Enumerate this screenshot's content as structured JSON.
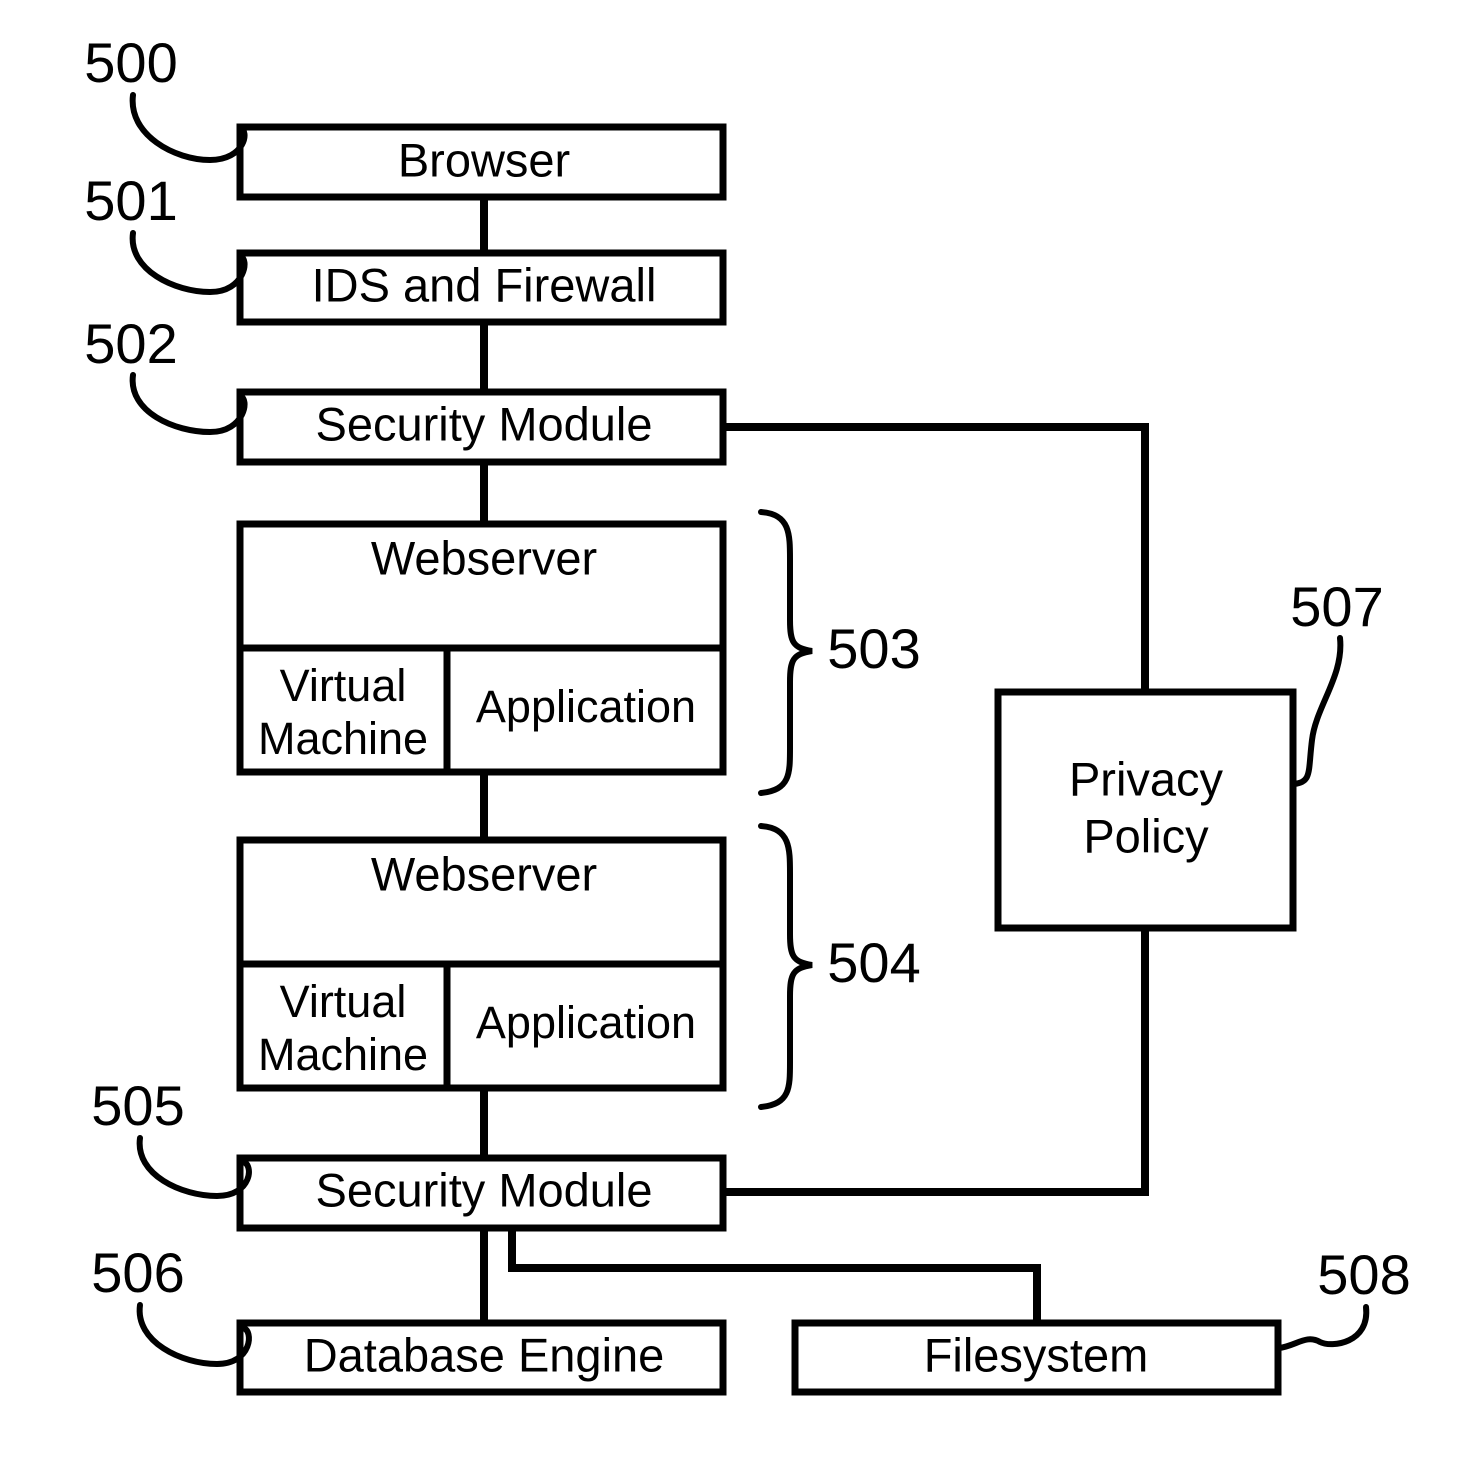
{
  "figure": {
    "title": "System architecture block diagram",
    "background_color": "#ffffff",
    "line_color": "#000000"
  },
  "nodes": {
    "browser": {
      "label": "Browser",
      "ref": "500"
    },
    "ids_firewall": {
      "label": "IDS and Firewall",
      "ref": "501"
    },
    "security_module_top": {
      "label": "Security Module",
      "ref": "502"
    },
    "webserver_upper": {
      "label": "Webserver",
      "ref": "503",
      "vm_label_line1": "Virtual",
      "vm_label_line2": "Machine",
      "application_label": "Application"
    },
    "webserver_lower": {
      "label": "Webserver",
      "ref": "504",
      "vm_label_line1": "Virtual",
      "vm_label_line2": "Machine",
      "application_label": "Application"
    },
    "security_module_bottom": {
      "label": "Security Module",
      "ref": "505"
    },
    "database_engine": {
      "label": "Database Engine",
      "ref": "506"
    },
    "privacy_policy": {
      "label_line1": "Privacy",
      "label_line2": "Policy",
      "ref": "507"
    },
    "filesystem": {
      "label": "Filesystem",
      "ref": "508"
    }
  },
  "reference_numerals": [
    "500",
    "501",
    "502",
    "503",
    "504",
    "505",
    "506",
    "507",
    "508"
  ]
}
